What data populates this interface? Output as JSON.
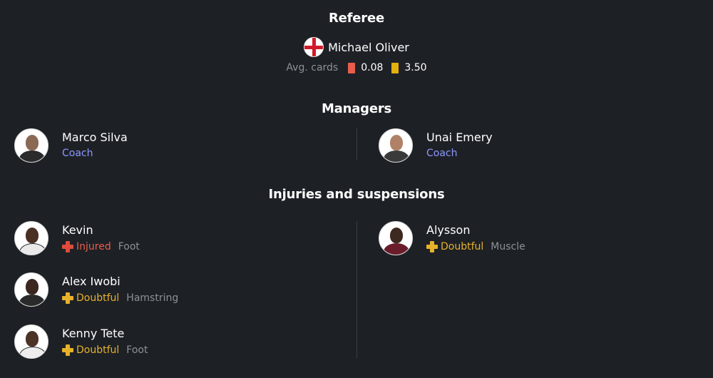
{
  "referee": {
    "section_title": "Referee",
    "name": "Michael Oliver",
    "flag_icon": "england-flag-icon",
    "avg_label": "Avg. cards",
    "red_avg": "0.08",
    "yellow_avg": "3.50"
  },
  "managers": {
    "section_title": "Managers",
    "home": {
      "name": "Marco Silva",
      "role": "Coach"
    },
    "away": {
      "name": "Unai Emery",
      "role": "Coach"
    }
  },
  "injuries": {
    "section_title": "Injuries and suspensions",
    "home": [
      {
        "name": "Kevin",
        "status": "Injured",
        "reason": "Foot"
      },
      {
        "name": "Alex Iwobi",
        "status": "Doubtful",
        "reason": "Hamstring"
      },
      {
        "name": "Kenny Tete",
        "status": "Doubtful",
        "reason": "Foot"
      }
    ],
    "away": [
      {
        "name": "Alysson",
        "status": "Doubtful",
        "reason": "Muscle"
      }
    ]
  },
  "colors": {
    "background": "#1d2126",
    "coach_role": "#8e97ff",
    "injured": "#e85d4c",
    "doubtful": "#e7b12a",
    "muted": "#8c9196"
  }
}
